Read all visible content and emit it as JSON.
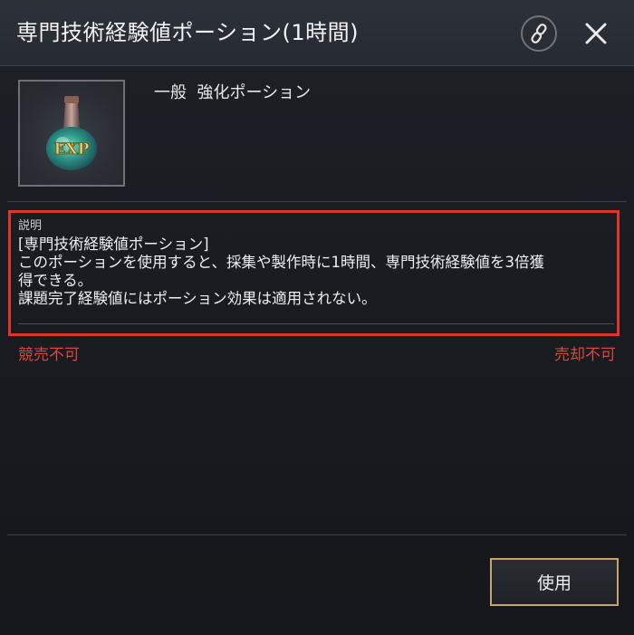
{
  "header": {
    "title": "専門技術経験値ポーション(1時間)"
  },
  "item": {
    "icon_name": "exp-potion-icon",
    "icon_text": "EXP",
    "type_label": "一般  強化ポーション"
  },
  "description": {
    "label": "説明",
    "lines": [
      "[専門技術経験値ポーション]",
      "このポーションを使用すると、採集や製作時に1時間、専門技術経験値を3倍獲",
      "得できる。",
      "課題完了経験値にはポーション効果は適用されない。"
    ]
  },
  "restrictions": {
    "auction": "競売不可",
    "sell": "売却不可"
  },
  "footer": {
    "use_label": "使用"
  },
  "colors": {
    "highlight_border": "#e0352a",
    "restriction_text": "#d9483d",
    "button_border": "#c6a46e"
  }
}
